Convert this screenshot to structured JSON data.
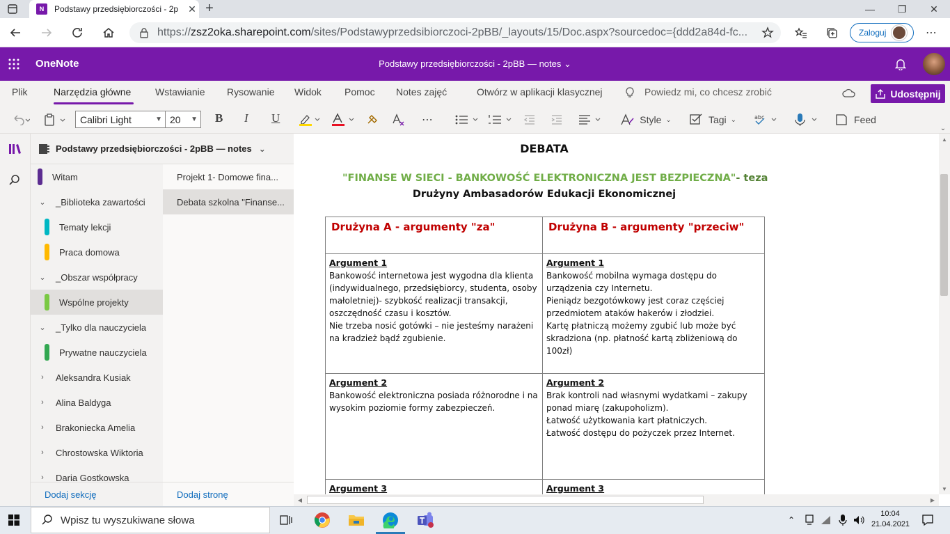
{
  "browser": {
    "tab_title": "Podstawy przedsiębiorczości - 2p",
    "favicon_letter": "N",
    "url_protocol": "https://",
    "url_host": "zsz2oka.sharepoint.com",
    "url_path": "/sites/Podstawyprzedsibiorczoci-2pBB/_layouts/15/Doc.aspx?sourcedoc={ddd2a84d-fc...",
    "login_label": "Zaloguj"
  },
  "onenote": {
    "brand": "OneNote",
    "notebook_title": "Podstawy przedsiębiorczości - 2pBB — notes ⌄"
  },
  "ribbon": {
    "tabs": [
      "Plik",
      "Narzędzia główne",
      "Wstawianie",
      "Rysowanie",
      "Widok",
      "Pomoc",
      "Notes zajęć",
      "Otwórz w aplikacji klasycznej"
    ],
    "tell_me": "Powiedz mi, co chcesz zrobić",
    "share_label": "Udostępnij"
  },
  "toolbar": {
    "font_name": "Calibri Light",
    "font_size": "20",
    "bold": "B",
    "italic": "I",
    "underline": "U",
    "style_label": "Style",
    "tags_label": "Tagi",
    "feed_label": "Feed"
  },
  "navigation": {
    "notebook_header": "Podstawy przedsiębiorczości - 2pBB — notes",
    "sections": [
      {
        "label": "Witam",
        "color": "#5c2d91",
        "type": "section"
      },
      {
        "label": "_Biblioteka zawartości",
        "type": "group",
        "expanded": true
      },
      {
        "label": "Tematy lekcji",
        "color": "#00b7c3",
        "type": "section"
      },
      {
        "label": "Praca domowa",
        "color": "#ffb900",
        "type": "section"
      },
      {
        "label": "_Obszar współpracy",
        "type": "group",
        "expanded": true
      },
      {
        "label": "Wspólne projekty",
        "color": "#7ac943",
        "type": "section",
        "selected": true
      },
      {
        "label": "_Tylko dla nauczyciela",
        "type": "group",
        "expanded": true
      },
      {
        "label": "Prywatne nauczyciela",
        "color": "#33a852",
        "type": "section"
      },
      {
        "label": "Aleksandra Kusiak",
        "type": "group",
        "expanded": false
      },
      {
        "label": "Alina Baldyga",
        "type": "group",
        "expanded": false
      },
      {
        "label": "Brakoniecka Amelia",
        "type": "group",
        "expanded": false
      },
      {
        "label": "Chrostowska Wiktoria",
        "type": "group",
        "expanded": false
      },
      {
        "label": "Daria Gostkowska",
        "type": "group",
        "expanded": false
      }
    ],
    "pages": [
      {
        "label": "Projekt 1- Domowe fina...",
        "selected": false
      },
      {
        "label": "Debata szkolna \"Finanse...",
        "selected": true
      }
    ],
    "add_section": "Dodaj sekcję",
    "add_page": "Dodaj stronę"
  },
  "note": {
    "title": "DEBATA",
    "thesis": "\"FINANSE W SIECI - BANKOWOŚĆ ELEKTRONICZNA JEST BEZPIECZNA\"",
    "thesis_suffix": "- teza",
    "subtitle": "Drużyny Ambasadorów Edukacji Ekonomicznej",
    "col_a": "Drużyna A - argumenty \"za\"",
    "col_b": "Drużyna B - argumenty \"przeciw\"",
    "rows": [
      {
        "a_title": "Argument 1",
        "a_lines": [
          "Bankowość internetowa jest wygodna dla klienta",
          "(indywidualnego, przedsiębiorcy, studenta, osoby",
          "małoletniej)- szybkość realizacji transakcji,",
          "oszczędność czasu i kosztów.",
          "Nie trzeba nosić gotówki – nie jesteśmy narażeni",
          "na kradzież bądź zgubienie."
        ],
        "b_title": "Argument 1",
        "b_lines": [
          "Bankowość mobilna wymaga dostępu do",
          "urządzenia czy Internetu.",
          "Pieniądz bezgotówkowy jest coraz częściej",
          "przedmiotem ataków hakerów i złodziei.",
          "Kartę płatniczą możemy zgubić lub może być",
          "skradziona (np. płatność kartą zbliżeniową do",
          "100zł)"
        ]
      },
      {
        "a_title": "Argument 2",
        "a_lines": [
          "Bankowość elektroniczna posiada różnorodne i na",
          "wysokim poziomie formy zabezpieczeń."
        ],
        "b_title": "Argument 2",
        "b_lines": [
          "Brak kontroli nad własnymi wydatkami – zakupy",
          "ponad miarę (zakupoholizm).",
          "Łatwość użytkowania kart płatniczych.",
          "Łatwość dostępu do pożyczek przez Internet."
        ]
      },
      {
        "a_title": "Argument 3",
        "a_lines": [],
        "b_title": "Argument 3",
        "b_lines": []
      }
    ]
  },
  "taskbar": {
    "search_placeholder": "Wpisz tu wyszukiwane słowa",
    "time": "10:04",
    "date": "21.04.2021"
  }
}
